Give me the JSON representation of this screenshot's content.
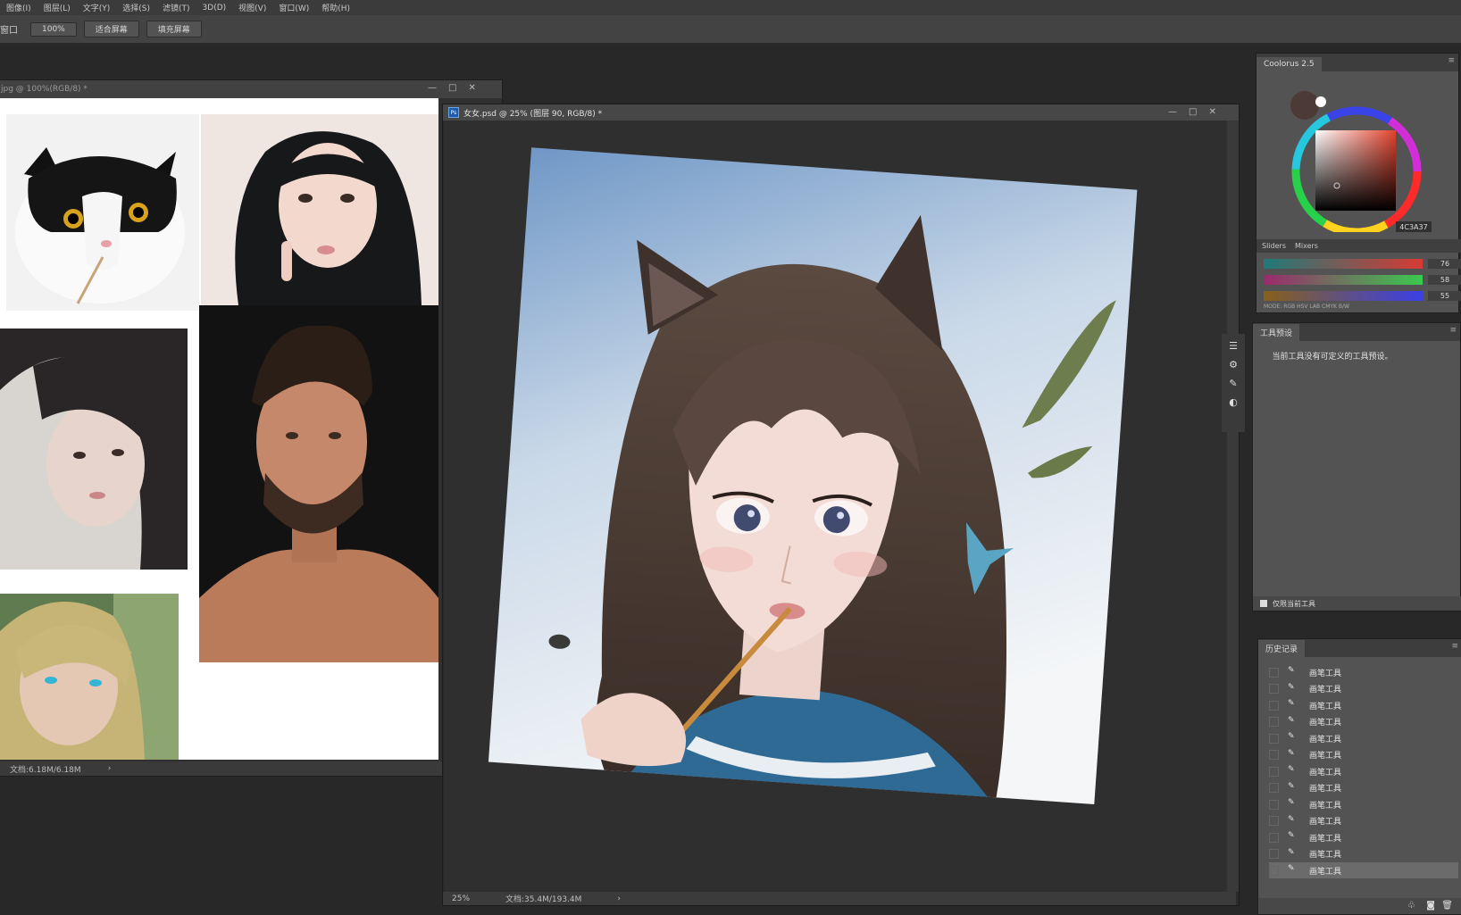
{
  "menubar": {
    "items": [
      "图像(I)",
      "图层(L)",
      "文字(Y)",
      "选择(S)",
      "滤镜(T)",
      "3D(D)",
      "视图(V)",
      "窗口(W)",
      "帮助(H)"
    ]
  },
  "options_bar": {
    "label": "窗口",
    "zoom_value": "100%",
    "fit_screen_label": "适合屏幕",
    "fill_screen_label": "填充屏幕"
  },
  "reference_window": {
    "title": "jpg @ 100%(RGB/8) *",
    "controls": [
      "—",
      "□",
      "✕"
    ],
    "status": "文档:6.18M/6.18M",
    "status_arrow": "›"
  },
  "main_window": {
    "title": "女女.psd @ 25% (图层 90, RGB/8) *",
    "controls": [
      "—",
      "□",
      "✕"
    ],
    "zoom": "25%",
    "doc_size": "文档:35.4M/193.4M",
    "status_arrow": "›"
  },
  "coolorus_panel": {
    "tab": "Coolorus 2.5",
    "hex": "4C3A37",
    "sub_tabs": [
      "Sliders",
      "Mixers"
    ],
    "sliders": [
      {
        "value": "76",
        "level": 0.3
      },
      {
        "value": "58",
        "level": 0.23
      },
      {
        "value": "55",
        "level": 0.22
      }
    ],
    "modes": "MODE: RGB  HSV  LAB  CMYK  B/W"
  },
  "tool_presets_panel": {
    "tab": "工具预设",
    "message": "当前工具没有可定义的工具预设。",
    "footer_checkbox_label": "仅限当前工具"
  },
  "history_panel": {
    "tab": "历史记录",
    "items": [
      "画笔工具",
      "画笔工具",
      "画笔工具",
      "画笔工具",
      "画笔工具",
      "画笔工具",
      "画笔工具",
      "画笔工具",
      "画笔工具",
      "画笔工具",
      "画笔工具",
      "画笔工具",
      "画笔工具"
    ]
  },
  "colors": {
    "foreground": "#4C3A37",
    "panel_bg": "#535353",
    "workspace_bg": "#282828"
  }
}
